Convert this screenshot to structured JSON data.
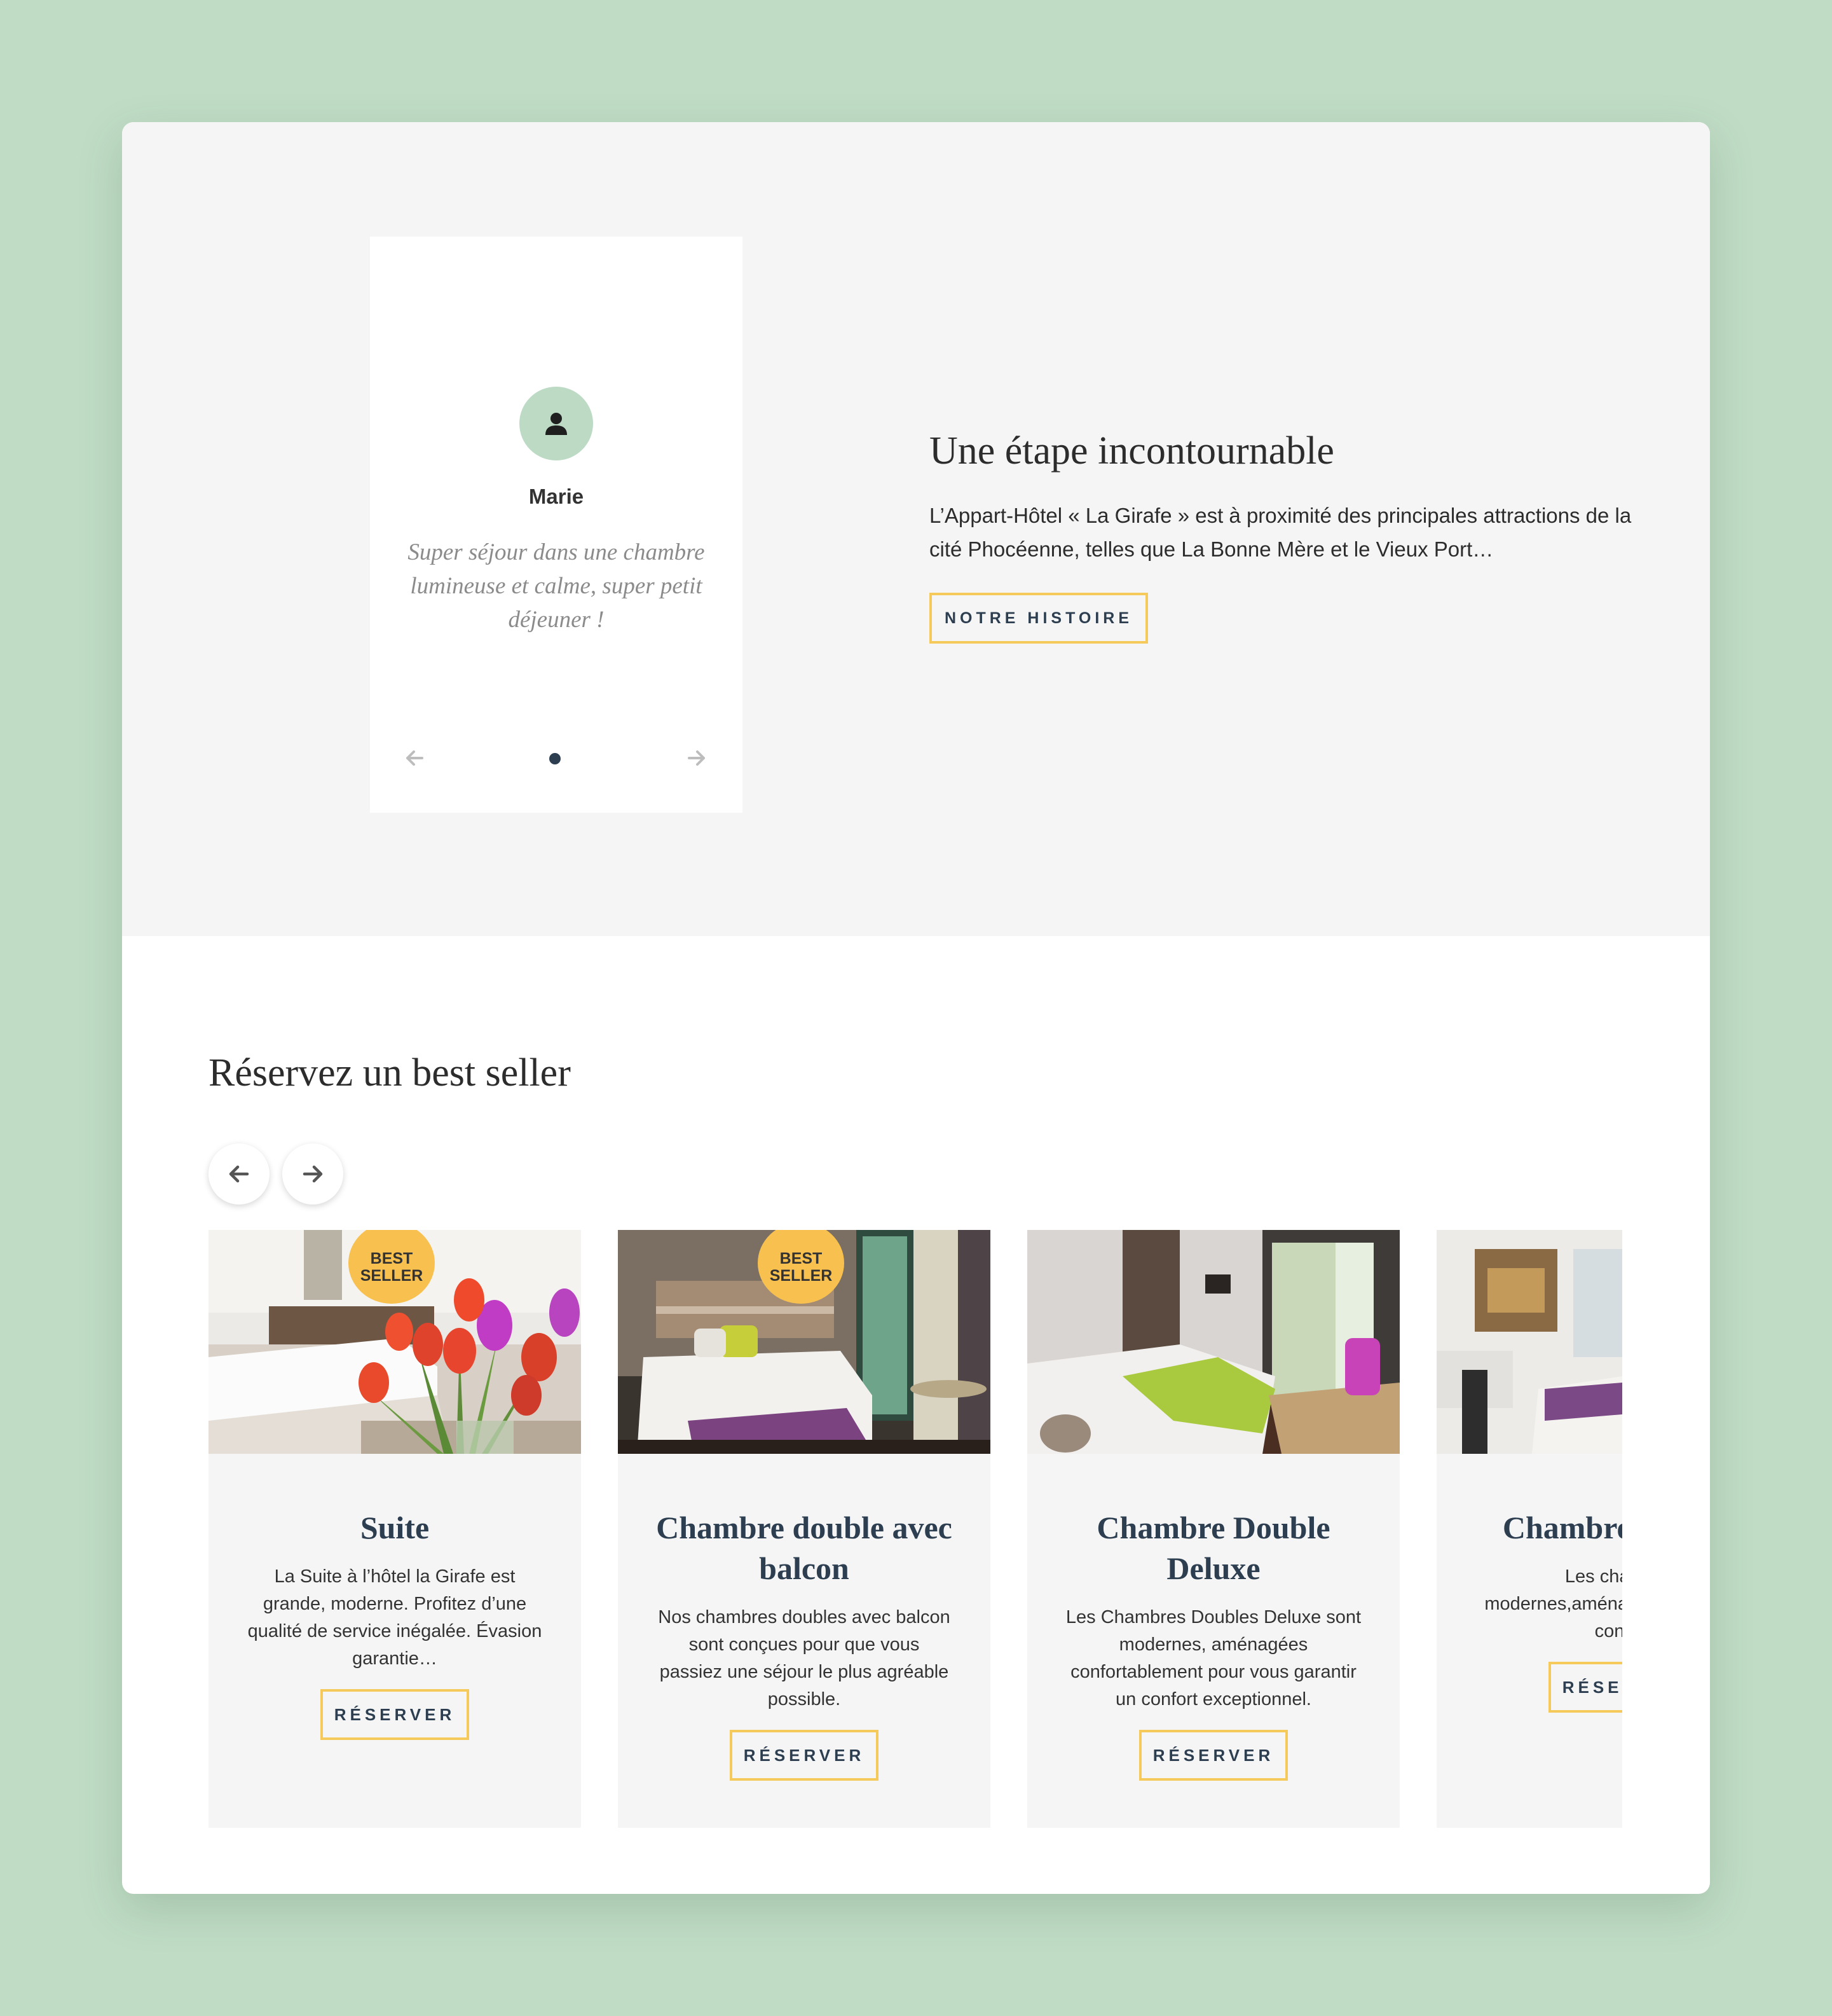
{
  "testimonial": {
    "author": "Marie",
    "quote": "Super séjour dans une chambre lumineuse et calme, super petit déjeuner !",
    "avatar_icon": "user-icon",
    "prev_icon": "arrow-left-icon",
    "next_icon": "arrow-right-icon",
    "pages": 1,
    "current_page": 1
  },
  "intro": {
    "title": "Une étape incontournable",
    "text": "L’Appart-Hôtel « La Girafe » est à proximité des principales attractions de la cité Phocéenne, telles que La Bonne Mère et le Vieux Port…",
    "button_label": "NOTRE HISTOIRE"
  },
  "bestsellers": {
    "title": "Réservez un best seller",
    "prev_icon": "arrow-left-icon",
    "next_icon": "arrow-right-icon",
    "cards": [
      {
        "title": "Suite",
        "text": "La Suite à l’hôtel la Girafe est grande, moderne. Profitez d’une qualité de service inégalée. Évasion garantie…",
        "button_label": "RÉSERVER",
        "badge": "BEST SELLER",
        "badge_line1": "BEST",
        "badge_line2": "SELLER"
      },
      {
        "title": "Chambre double avec balcon",
        "text": "Nos chambres doubles avec balcon sont conçues pour que vous passiez une séjour le plus agréable possible.",
        "button_label": "RÉSERVER",
        "badge": "BEST SELLER",
        "badge_line1": "BEST",
        "badge_line2": "SELLER"
      },
      {
        "title": "Chambre Double Deluxe",
        "text": "Les Chambres Doubles Deluxe sont modernes, aménagées confortablement pour vous garantir un confort exceptionnel.",
        "button_label": "RÉSERVER"
      },
      {
        "title": "Chambre (studio)",
        "text": "Les chambres modernes,aménagées garantir un confort",
        "button_label": "RÉSERVER"
      }
    ]
  },
  "colors": {
    "page_background": "#c0dcc5",
    "accent_border": "#f5c95a",
    "badge": "#f8c14f",
    "heading_navy": "#2c3e50",
    "avatar": "#bcdac4"
  }
}
